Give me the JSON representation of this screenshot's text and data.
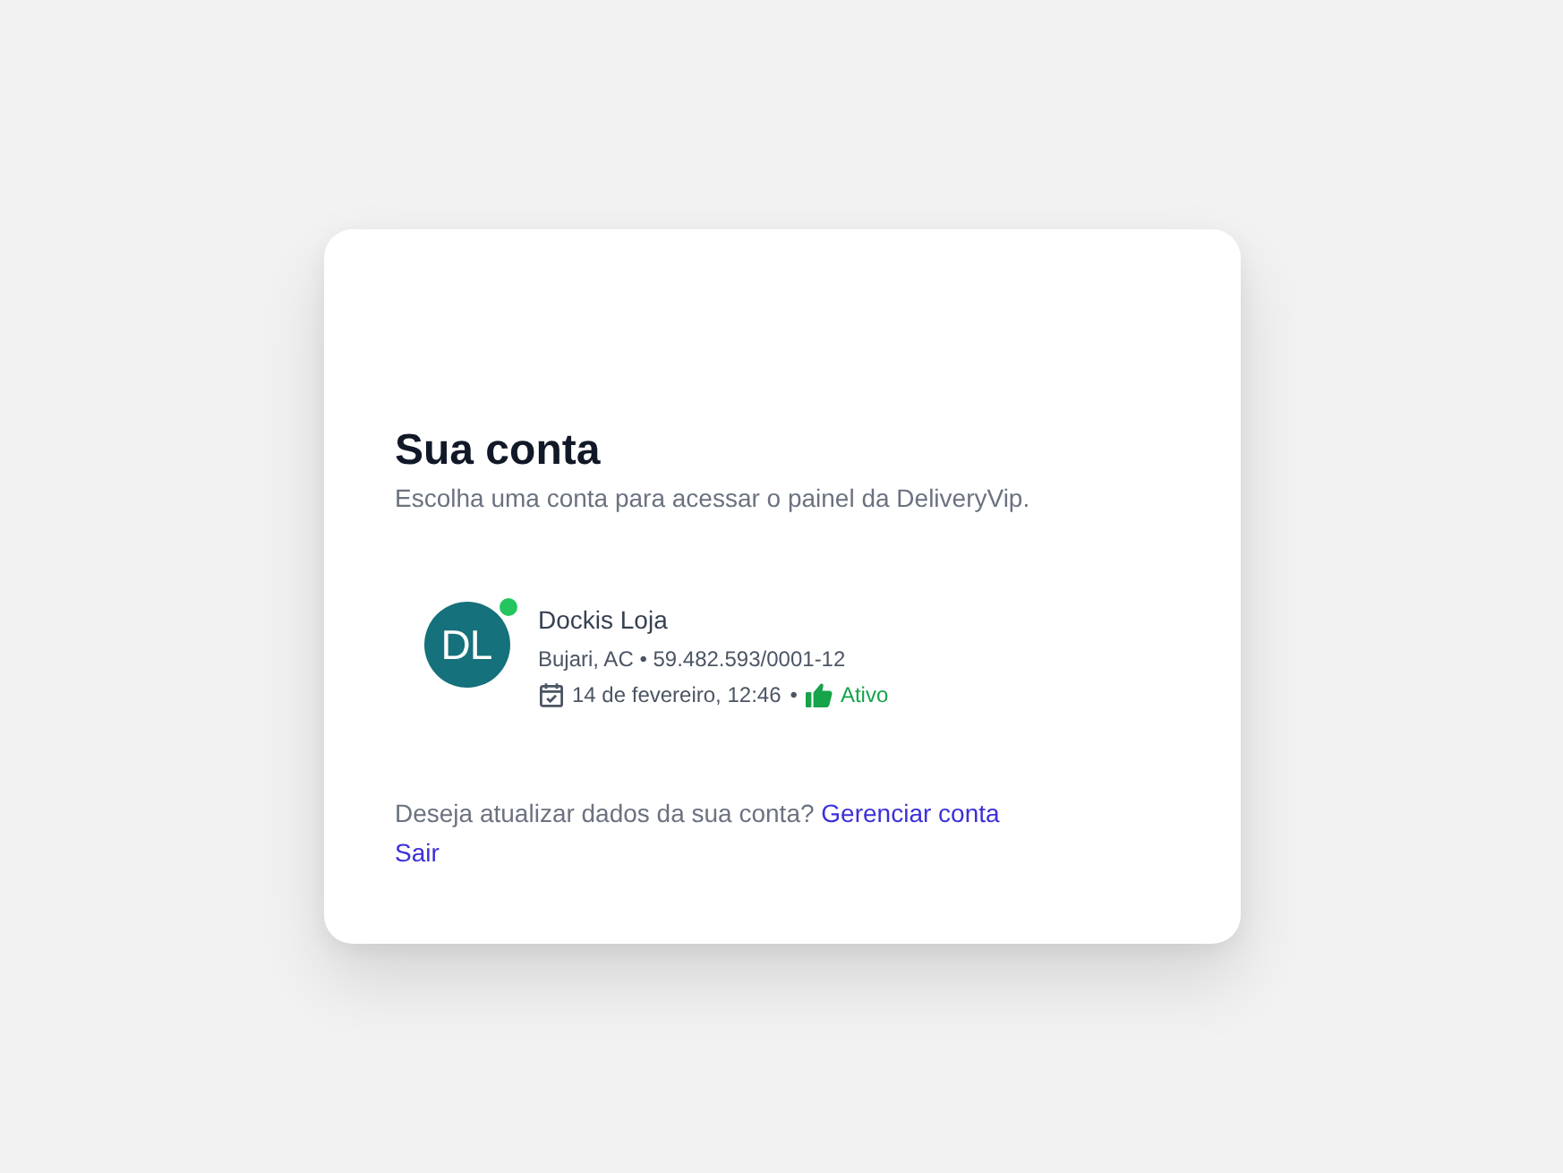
{
  "card": {
    "title": "Sua conta",
    "subtitle": "Escolha uma conta para acessar o painel da DeliveryVip."
  },
  "accounts": [
    {
      "initials": "DL",
      "color": "#15717b",
      "online": true,
      "name": "Dockis Loja",
      "details": "Bujari, AC • 59.482.593/0001-12",
      "date": "14 de fevereiro, 12:46",
      "separator": "•",
      "status": "Ativo",
      "active": true
    }
  ],
  "footer": {
    "question": "Deseja atualizar dados da sua conta?",
    "manage_link": "Gerenciar conta",
    "logout_link": "Sair"
  }
}
